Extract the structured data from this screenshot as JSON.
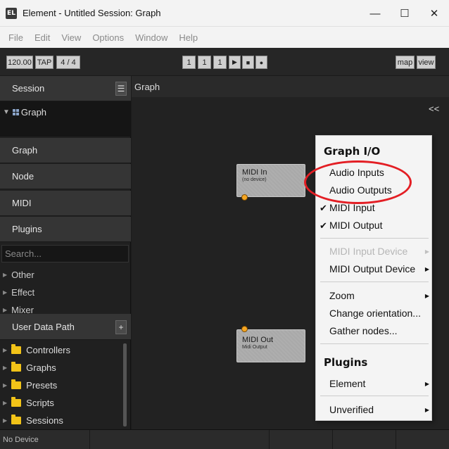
{
  "window": {
    "app_icon": "EL",
    "title": "Element - Untitled Session: Graph",
    "minimize": "—",
    "maximize": "☐",
    "close": "✕"
  },
  "menubar": [
    "File",
    "Edit",
    "View",
    "Options",
    "Window",
    "Help"
  ],
  "toolbar": {
    "tempo": "120.00",
    "tap": "TAP",
    "time_signature": "4 / 4",
    "bar": "1",
    "beat": "1",
    "tick": "1",
    "play": "▶",
    "stop": "■",
    "record": "●",
    "map": "map",
    "view": "view"
  },
  "sidebar": {
    "session_label": "Session",
    "session_menu_icon": "☰",
    "tree_item": "Graph",
    "sections": [
      "Graph",
      "Node",
      "MIDI",
      "Plugins"
    ],
    "search_placeholder": "Search...",
    "categories": [
      "Other",
      "Effect",
      "Mixer"
    ],
    "user_data_path_label": "User Data Path",
    "add_icon": "+",
    "folders": [
      "Controllers",
      "Graphs",
      "Presets",
      "Scripts",
      "Sessions"
    ]
  },
  "graph": {
    "tab_label": "Graph",
    "collapse_label": "<<",
    "nodes": [
      {
        "title": "MIDI In",
        "subtitle": "(no device)"
      },
      {
        "title": "MIDI Out",
        "subtitle": "Midi Output"
      }
    ]
  },
  "context_menu": {
    "header_graph_io": "Graph I/O",
    "audio_inputs": "Audio Inputs",
    "audio_outputs": "Audio Outputs",
    "midi_input": "MIDI Input",
    "midi_output": "MIDI Output",
    "checkmark": "✔",
    "midi_input_device": "MIDI Input Device",
    "midi_output_device": "MIDI Output Device",
    "zoom": "Zoom",
    "change_orientation": "Change orientation...",
    "gather_nodes": "Gather nodes...",
    "header_plugins": "Plugins",
    "element": "Element",
    "unverified": "Unverified",
    "submenu_arrow": "▶"
  },
  "statusbar": {
    "device": "No Device"
  },
  "colors": {
    "annotation_red": "#e31e24",
    "folder_yellow": "#f2c318",
    "port_orange": "#f5a623"
  }
}
